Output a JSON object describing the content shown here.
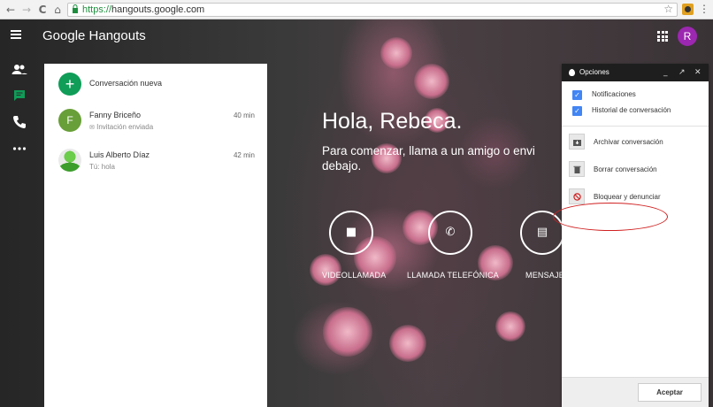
{
  "browser": {
    "url_scheme": "https://",
    "url_host": "hangouts.google.com",
    "nav": {
      "back": "←",
      "forward": "→",
      "reload": "C",
      "home": "⌂"
    },
    "bookmark_icon": "star-icon",
    "menu_icon": "⋮"
  },
  "app": {
    "title": "Google Hangouts",
    "avatar_letter": "R",
    "avatar_color": "#9c27b0",
    "accent_green": "#0f9d58"
  },
  "rail": {
    "items": [
      {
        "name": "menu-icon"
      },
      {
        "name": "contacts-icon"
      },
      {
        "name": "messages-icon",
        "active": true
      },
      {
        "name": "phone-icon"
      },
      {
        "name": "more-icon"
      }
    ]
  },
  "conversations": {
    "new_label": "Conversación nueva",
    "items": [
      {
        "initial": "F",
        "name": "Fanny Briceño",
        "sub": "Invitación enviada",
        "time": "40 min"
      },
      {
        "initial": "",
        "name": "Luis Alberto Díaz",
        "sub": "Tú: hola",
        "time": "42 min"
      }
    ]
  },
  "welcome": {
    "greeting": "Hola, Rebeca.",
    "line1": "Para comenzar, llama a un amigo o envi",
    "line2": "debajo.",
    "actions": [
      {
        "label": "VIDEOLLAMADA",
        "icon": "■"
      },
      {
        "label": "LLAMADA TELEFÓNICA",
        "icon": "✆"
      },
      {
        "label": "MENSAJE",
        "icon": "▤"
      }
    ]
  },
  "options": {
    "title": "Opciones",
    "controls": {
      "minimize": "_",
      "popout": "↗",
      "close": "✕"
    },
    "checkboxes": [
      {
        "label": "Notificaciones",
        "checked": true
      },
      {
        "label": "Historial de conversación",
        "checked": true
      }
    ],
    "actions": [
      {
        "label": "Archivar conversación",
        "icon": "archive-icon"
      },
      {
        "label": "Borrar conversación",
        "icon": "trash-icon"
      },
      {
        "label": "Bloquear y denunciar",
        "icon": "block-icon"
      }
    ],
    "accept_label": "Aceptar",
    "highlight_color": "#d02020"
  }
}
